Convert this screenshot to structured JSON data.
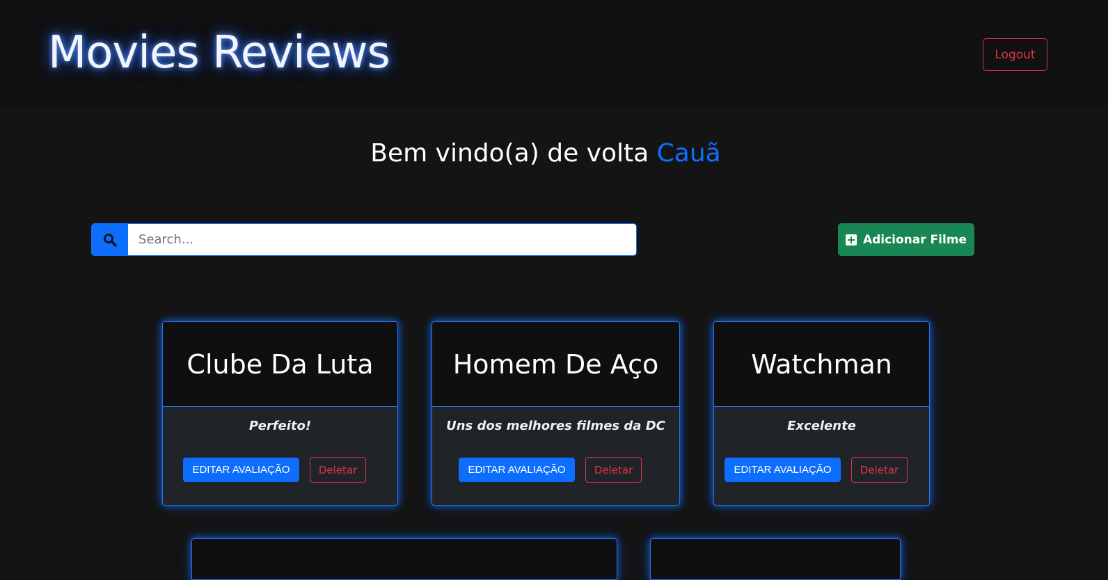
{
  "header": {
    "app_title": "Movies Reviews",
    "logout_label": "Logout"
  },
  "welcome": {
    "prefix": "Bem vindo(a) de volta",
    "user_name": "Cauã"
  },
  "toolbar": {
    "search_placeholder": "Search...",
    "search_value": "",
    "add_movie_label": "Adicionar Filme"
  },
  "movies": [
    {
      "title": "Clube Da Luta",
      "review": "Perfeito!",
      "edit_label": "EDITAR AVALIAÇÃO",
      "delete_label": "Deletar"
    },
    {
      "title": "Homem De Aço",
      "review": "Uns dos melhores filmes da DC",
      "edit_label": "EDITAR AVALIAÇÃO",
      "delete_label": "Deletar"
    },
    {
      "title": "Watchman",
      "review": "Excelente",
      "edit_label": "EDITAR AVALIAÇÃO",
      "delete_label": "Deletar"
    }
  ],
  "colors": {
    "accent": "#0d6efd",
    "success": "#198754",
    "danger": "#dc3545",
    "background": "#141415",
    "header_background": "#111112",
    "card_body": "#202328"
  },
  "icons": {
    "search": "search-icon",
    "add": "plus-square-icon"
  }
}
